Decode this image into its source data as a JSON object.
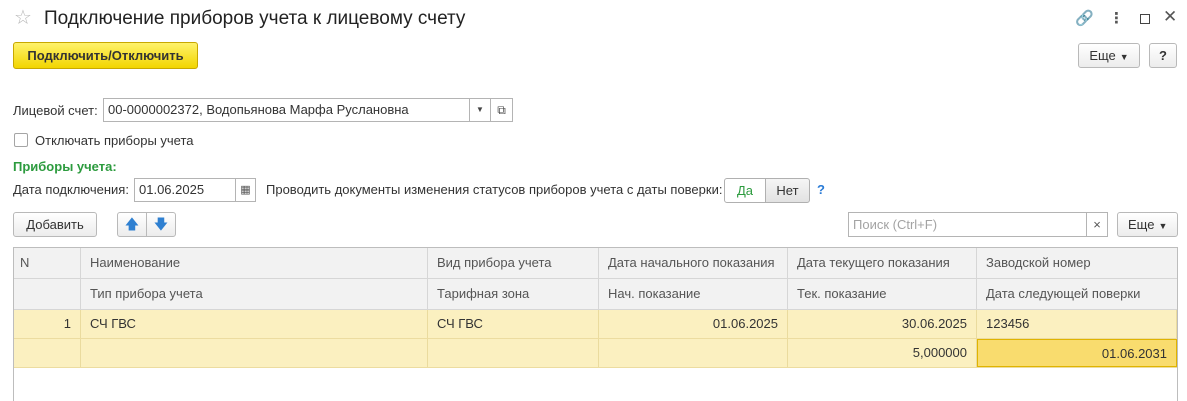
{
  "window": {
    "title": "Подключение приборов учета к лицевому счету",
    "icons": [
      "star-icon",
      "link-icon",
      "more-vertical-icon",
      "maximize-icon",
      "close-icon"
    ]
  },
  "toolbar": {
    "connect_label": "Подключить/Отключить",
    "more_label": "Еще",
    "help_label": "?"
  },
  "account": {
    "label": "Лицевой счет:",
    "value": "00-0000002372, Водопьянова Марфа Руслановна"
  },
  "disconnect": {
    "label": "Отключать приборы учета",
    "checked": false
  },
  "meters_section": {
    "title": "Приборы учета:",
    "date_label": "Дата подключения:",
    "date_value": "01.06.2025",
    "verify_label": "Проводить документы изменения статусов приборов учета с даты поверки:",
    "yes": "Да",
    "no": "Нет",
    "help": "?"
  },
  "grid_toolbar": {
    "add_label": "Добавить",
    "search_placeholder": "Поиск (Ctrl+F)",
    "clear": "×",
    "more_label": "Еще"
  },
  "grid": {
    "header_row1": [
      "N",
      "Наименование",
      "Вид прибора учета",
      "Дата начального показания",
      "Дата текущего показания",
      "Заводской номер"
    ],
    "header_row2": [
      "",
      "Тип прибора учета",
      "Тарифная зона",
      "Нач. показание",
      "Тек. показание",
      "Дата следующей поверки"
    ],
    "rows": [
      {
        "line1": [
          "1",
          "СЧ ГВС",
          "СЧ ГВС",
          "01.06.2025",
          "30.06.2025",
          "123456"
        ],
        "line2": [
          "",
          "",
          "",
          "",
          "5,000000",
          "01.06.2031"
        ]
      }
    ]
  },
  "colors": {
    "accent_yellow": "#f2d500",
    "section_green": "#2c9b3e",
    "row_highlight": "#fbf0c0",
    "selected_cell": "#f9dc6e"
  }
}
